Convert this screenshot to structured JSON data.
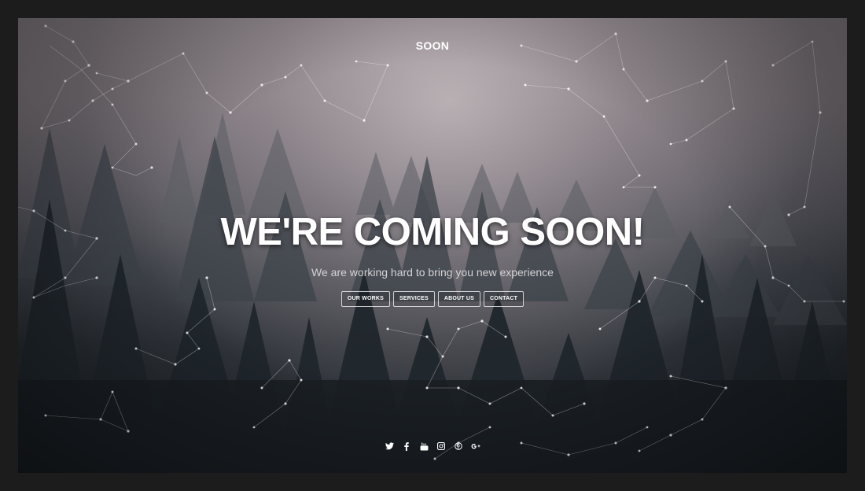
{
  "brand": "SOON",
  "headline": "WE'RE COMING SOON!",
  "subline": "We are working hard to bring you new experience",
  "nav": [
    {
      "label": "OUR WORKS"
    },
    {
      "label": "SERVICES"
    },
    {
      "label": "ABOUT US"
    },
    {
      "label": "CONTACT"
    }
  ],
  "social": [
    {
      "icon": "twitter-icon"
    },
    {
      "icon": "facebook-icon"
    },
    {
      "icon": "youtube-icon"
    },
    {
      "icon": "instagram-icon"
    },
    {
      "icon": "pinterest-icon"
    },
    {
      "icon": "google-plus-icon"
    }
  ]
}
